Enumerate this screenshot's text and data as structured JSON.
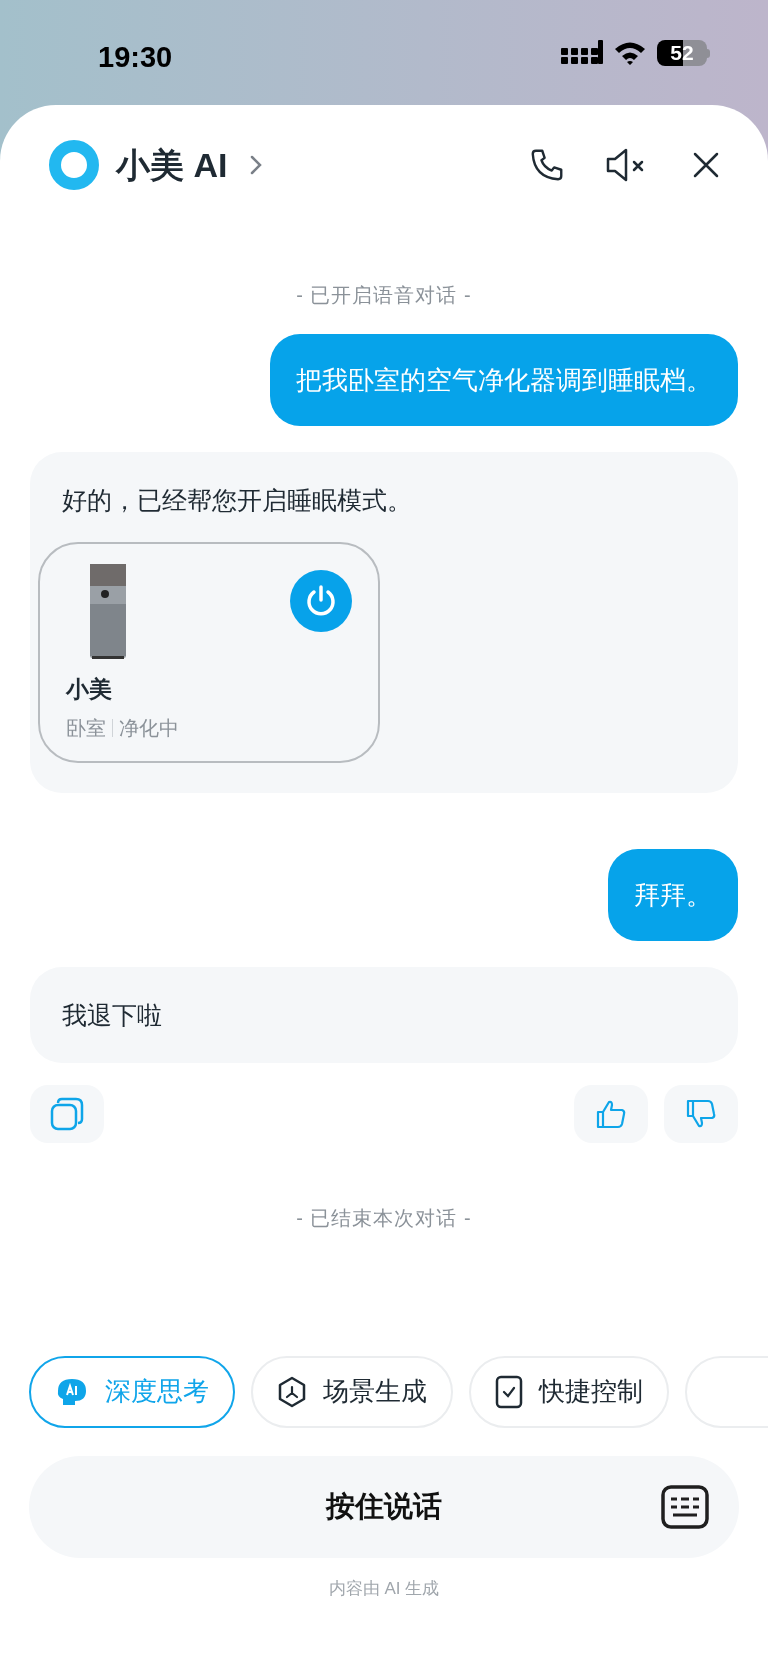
{
  "status_bar": {
    "time": "19:30",
    "battery": "52"
  },
  "header": {
    "title": "小美 AI"
  },
  "messages": [
    {
      "kind": "notice",
      "text": "- 已开启语音对话 -"
    },
    {
      "kind": "user",
      "text": "把我卧室的空气净化器调到睡眠档。"
    },
    {
      "kind": "assistant",
      "text": "好的，已经帮您开启睡眠模式。",
      "device": {
        "name": "小美",
        "room": "卧室",
        "status": "净化中",
        "on": true
      }
    },
    {
      "kind": "user",
      "text": "拜拜。"
    },
    {
      "kind": "assistant",
      "text": "我退下啦"
    },
    {
      "kind": "actions"
    },
    {
      "kind": "notice",
      "text": "- 已结束本次对话 -"
    }
  ],
  "chips": [
    {
      "label": "深度思考",
      "kind": "thinking",
      "selected": true
    },
    {
      "label": "场景生成",
      "kind": "scene",
      "selected": false
    },
    {
      "label": "快捷控制",
      "kind": "control",
      "selected": false
    }
  ],
  "talk_button": "按住说话",
  "disclaimer": "内容由 AI 生成"
}
